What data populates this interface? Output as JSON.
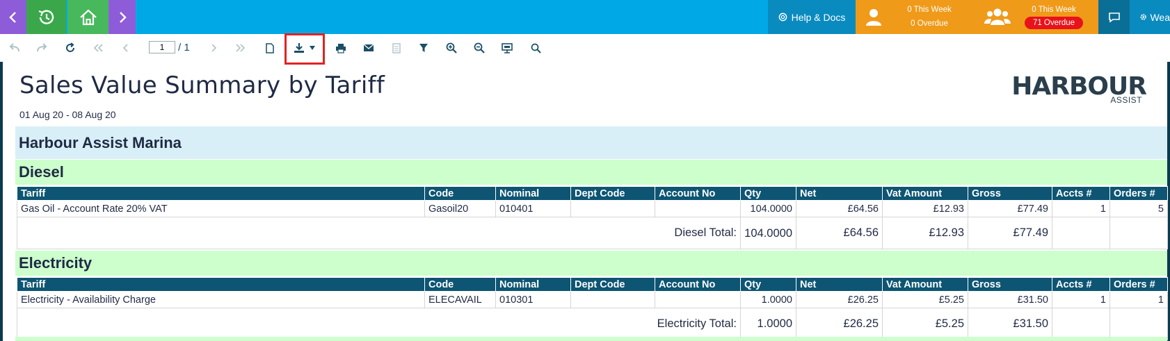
{
  "topbar": {
    "help_label": "Help & Docs",
    "user_this_week": "0 This Week",
    "user_overdue": "0 Overdue",
    "team_this_week": "0 This Week",
    "team_overdue": "71 Overdue",
    "weather_label": "Wea",
    "colors": {
      "bar": "#00a9e6",
      "nav_purple": "#8e5bd9",
      "nav_green": "#3aa84a",
      "orange": "#f09a1a",
      "overdue_red": "#e8121b"
    }
  },
  "toolbar": {
    "page_value": "1",
    "page_of": "/ 1",
    "icons": [
      "undo-icon",
      "redo-icon",
      "refresh-icon",
      "first-page-icon",
      "prev-page-icon",
      "next-page-icon",
      "last-page-icon",
      "new-document-icon",
      "export-icon",
      "print-icon",
      "email-icon",
      "document-icon",
      "filter-icon",
      "zoom-in-icon",
      "zoom-out-icon",
      "presentation-icon",
      "search-icon"
    ]
  },
  "report": {
    "title": "Sales Value Summary by Tariff",
    "date_range": "01 Aug 20 - 08 Aug 20",
    "logo_main": "HARBOUR",
    "logo_sub": "ASSIST",
    "site": "Harbour Assist Marina",
    "columns": [
      "Tariff",
      "Code",
      "Nominal",
      "Dept Code",
      "Account No",
      "Qty",
      "Net",
      "Vat Amount",
      "Gross",
      "Accts #",
      "Orders #"
    ],
    "groups": [
      {
        "name": "Diesel",
        "rows": [
          {
            "tariff": "Gas Oil - Account Rate 20% VAT",
            "code": "Gasoil20",
            "nominal": "010401",
            "dept": "",
            "account": "",
            "qty": "104.0000",
            "net": "£64.56",
            "vat": "£12.93",
            "gross": "£77.49",
            "accts": "1",
            "orders": "5"
          }
        ],
        "total": {
          "label": "Diesel Total:",
          "qty": "104.0000",
          "net": "£64.56",
          "vat": "£12.93",
          "gross": "£77.49"
        }
      },
      {
        "name": "Electricity",
        "rows": [
          {
            "tariff": "Electricity - Availability Charge",
            "code": "ELECAVAIL",
            "nominal": "010301",
            "dept": "",
            "account": "",
            "qty": "1.0000",
            "net": "£26.25",
            "vat": "£5.25",
            "gross": "£31.50",
            "accts": "1",
            "orders": "1"
          }
        ],
        "total": {
          "label": "Electricity Total:",
          "qty": "1.0000",
          "net": "£26.25",
          "vat": "£5.25",
          "gross": "£31.50"
        }
      }
    ]
  }
}
